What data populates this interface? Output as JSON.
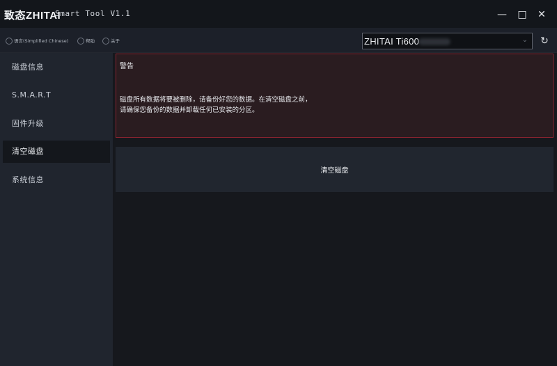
{
  "titlebar": {
    "logo": "致态ZHITAI",
    "app_title": "Smart Tool V1.1",
    "minimize": "—",
    "maximize": "□",
    "close": "✕"
  },
  "toolbar": {
    "language": "语言(Simplified Chinese)",
    "help": "帮助",
    "about": "关于",
    "device": "ZHITAI Ti600",
    "refresh_icon": "↻"
  },
  "sidebar": {
    "items": [
      {
        "label": "磁盘信息"
      },
      {
        "label": "S.M.A.R.T"
      },
      {
        "label": "固件升级"
      },
      {
        "label": "清空磁盘",
        "active": true
      },
      {
        "label": "系统信息"
      }
    ]
  },
  "main": {
    "warning_title": "警告",
    "warning_line1": "磁盘所有数据将要被删除，请备份好您的数据。在清空磁盘之前，",
    "warning_line2": "请确保您备份的数据并卸载任何已安装的分区。",
    "erase_button": "清空磁盘"
  },
  "colors": {
    "warning_border": "#8b2430",
    "warning_bg": "#2a1c20",
    "sidebar_bg": "#20252e",
    "active_item_bg": "#14171c"
  }
}
